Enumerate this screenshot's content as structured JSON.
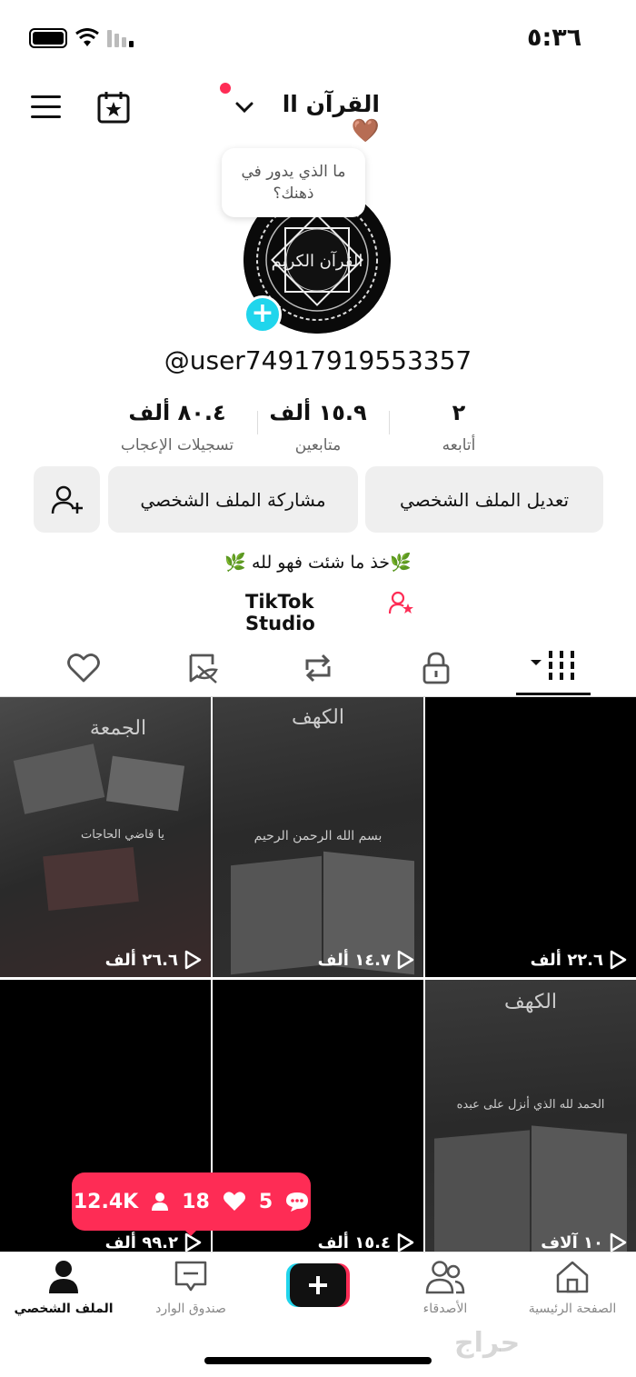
{
  "status_bar": {
    "time": "٥:٣٦"
  },
  "header": {
    "title": "القرآن ll 🤎"
  },
  "bubble": {
    "text": "ما الذي يدور في ذهنك؟"
  },
  "avatar": {
    "label": "القرآن الكريم"
  },
  "profile": {
    "username": "@user74917919553357"
  },
  "stats": {
    "likes": {
      "value": "٨٠.٤ ألف",
      "label": "تسجيلات الإعجاب"
    },
    "followers": {
      "value": "١٥.٩ ألف",
      "label": "متابعين"
    },
    "following": {
      "value": "٢",
      "label": "أتابعه"
    }
  },
  "buttons": {
    "edit": "تعديل الملف الشخصي",
    "share": "مشاركة الملف الشخصي"
  },
  "bio": {
    "text": "🌿خذ ما شئت فهو لله 🌿",
    "studio": "TikTok Studio"
  },
  "videos": [
    {
      "views": "٢٦.٦ ألف",
      "title": "الجمعة",
      "line": "يا قاضي الحاجات"
    },
    {
      "views": "١٤.٧ ألف",
      "title": "الكهف",
      "line": "بسم الله الرحمن الرحيم"
    },
    {
      "views": "٢٢.٦ ألف",
      "title": "",
      "line": ""
    },
    {
      "views": "٩٩.٢ ألف",
      "title": "",
      "line": ""
    },
    {
      "views": "١٥.٤ ألف",
      "title": "",
      "line": ""
    },
    {
      "views": "١٠ آلاف",
      "title": "الكهف",
      "line": "الحمد لله الذي أنزل على عبده"
    }
  ],
  "toast": {
    "views": "12.4K",
    "likes": "18",
    "comments": "5"
  },
  "nav": {
    "profile": "الملف الشخصي",
    "inbox": "صندوق الوارد",
    "friends": "الأصدقاء",
    "home": "الصفحة الرئيسية"
  },
  "watermark": {
    "text": "حراج"
  },
  "colors": {
    "accent": "#fe2c55",
    "cyan": "#20d5ec"
  }
}
